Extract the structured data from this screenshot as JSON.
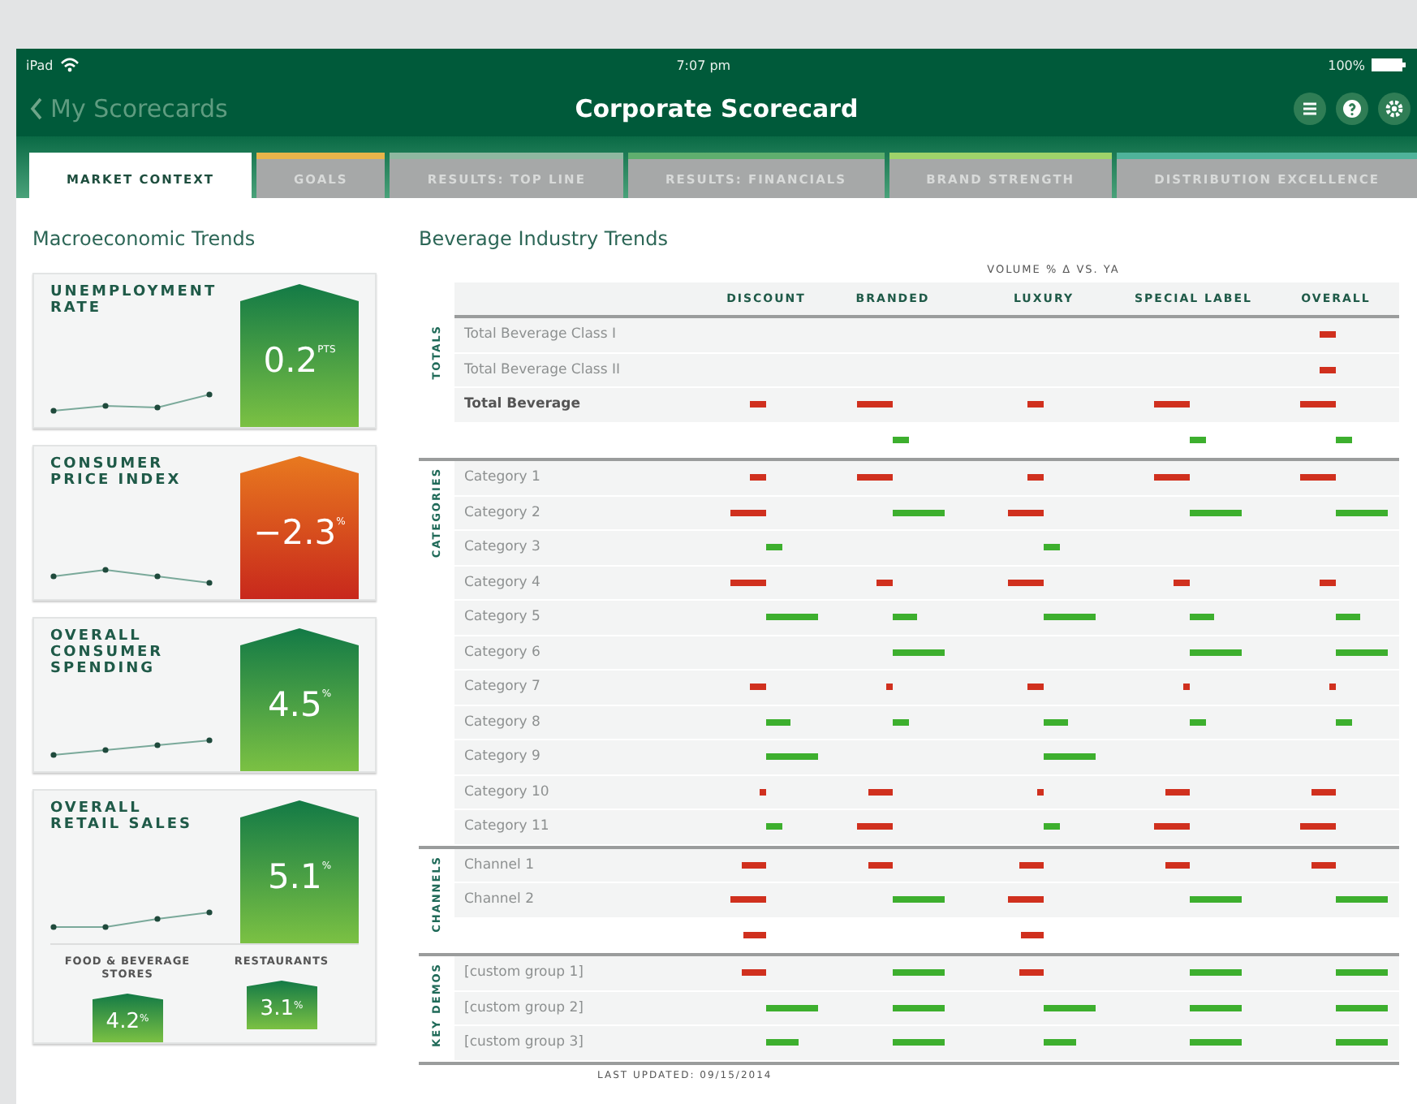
{
  "status_bar": {
    "device": "iPad",
    "time": "7:07 pm",
    "battery": "100%"
  },
  "header": {
    "back": "My Scorecards",
    "title": "Corporate Scorecard"
  },
  "tabs": [
    {
      "label": "MARKET CONTEXT",
      "selected": true,
      "color": "#ffffff"
    },
    {
      "label": "GOALS",
      "selected": false,
      "color": "#e8b44a"
    },
    {
      "label": "RESULTS: TOP LINE",
      "selected": false,
      "color": "#8fb8a0"
    },
    {
      "label": "RESULTS: FINANCIALS",
      "selected": false,
      "color": "#5fae6e"
    },
    {
      "label": "BRAND STRENGTH",
      "selected": false,
      "color": "#9fd36a"
    },
    {
      "label": "DISTRIBUTION EXCELLENCE",
      "selected": false,
      "color": "#4fb39a"
    }
  ],
  "macro": {
    "title": "Macroeconomic Trends",
    "cards": [
      {
        "title": "UNEMPLOYMENT RATE",
        "value": "0.2",
        "unit": "PTS",
        "kind": "up"
      },
      {
        "title": "CONSUMER PRICE INDEX",
        "value": "−2.3",
        "unit": "%",
        "kind": "down"
      },
      {
        "title": "OVERALL CONSUMER SPENDING",
        "value": "4.5",
        "unit": "%",
        "kind": "up"
      },
      {
        "title": "OVERALL RETAIL SALES",
        "value": "5.1",
        "unit": "%",
        "kind": "up",
        "subs": [
          {
            "title": "FOOD & BEVERAGE STORES",
            "value": "4.2",
            "unit": "%",
            "kind": "up"
          },
          {
            "title": "RESTAURANTS",
            "value": "3.1",
            "unit": "%",
            "kind": "up"
          }
        ]
      }
    ]
  },
  "industry": {
    "title": "Beverage Industry Trends",
    "group_header": "VOLUME % Δ VS. YA",
    "columns": [
      "DISCOUNT",
      "BRANDED",
      "LUXURY",
      "SPECIAL LABEL",
      "OVERALL"
    ],
    "sections": [
      {
        "label": "TOTALS",
        "rows": [
          {
            "label": "Total Beverage Class I",
            "bold": false,
            "cells": [
              null,
              null,
              null,
              null,
              {
                "kind": "down",
                "level": 0.3
              }
            ]
          },
          {
            "label": "Total Beverage Class II",
            "bold": false,
            "cells": [
              null,
              null,
              null,
              null,
              {
                "kind": "down",
                "level": 0.3
              }
            ]
          },
          {
            "label": "Total Beverage",
            "bold": true,
            "cells": [
              {
                "kind": "down",
                "level": 0.3
              },
              {
                "kind": "down",
                "level": 0.65
              },
              {
                "kind": "down",
                "level": 0.3
              },
              {
                "kind": "down",
                "level": 0.65
              },
              {
                "kind": "down",
                "level": 0.65
              }
            ]
          },
          {
            "cells": [
              null,
              {
                "kind": "up",
                "level": 0.3
              },
              null,
              {
                "kind": "up",
                "level": 0.3
              },
              {
                "kind": "up",
                "level": 0.3
              }
            ]
          }
        ]
      },
      {
        "label": "CATEGORIES",
        "rows": [
          {
            "label": "Category 1",
            "bold": false,
            "cells": [
              {
                "kind": "down",
                "level": 0.3
              },
              {
                "kind": "down",
                "level": 0.65
              },
              {
                "kind": "down",
                "level": 0.3
              },
              {
                "kind": "down",
                "level": 0.65
              },
              {
                "kind": "down",
                "level": 0.65
              }
            ]
          },
          {
            "label": "Category 2",
            "bold": false,
            "cells": [
              {
                "kind": "down",
                "level": 0.65
              },
              {
                "kind": "up",
                "level": 0.95
              },
              {
                "kind": "down",
                "level": 0.65
              },
              {
                "kind": "up",
                "level": 0.95
              },
              {
                "kind": "up",
                "level": 0.95
              }
            ]
          },
          {
            "label": "Category 3",
            "bold": false,
            "cells": [
              {
                "kind": "up",
                "level": 0.3
              },
              null,
              {
                "kind": "up",
                "level": 0.3
              },
              null,
              null
            ]
          },
          {
            "label": "Category 4",
            "bold": false,
            "cells": [
              {
                "kind": "down",
                "level": 0.65
              },
              {
                "kind": "down",
                "level": 0.3
              },
              {
                "kind": "down",
                "level": 0.65
              },
              {
                "kind": "down",
                "level": 0.3
              },
              {
                "kind": "down",
                "level": 0.3
              }
            ]
          },
          {
            "label": "Category 5",
            "bold": false,
            "cells": [
              {
                "kind": "up",
                "level": 0.95
              },
              {
                "kind": "up",
                "level": 0.45
              },
              {
                "kind": "up",
                "level": 0.95
              },
              {
                "kind": "up",
                "level": 0.45
              },
              {
                "kind": "up",
                "level": 0.45
              }
            ]
          },
          {
            "label": "Category 6",
            "bold": false,
            "cells": [
              null,
              {
                "kind": "up",
                "level": 0.95
              },
              null,
              {
                "kind": "up",
                "level": 0.95
              },
              {
                "kind": "up",
                "level": 0.95
              }
            ]
          },
          {
            "label": "Category 7",
            "bold": false,
            "cells": [
              {
                "kind": "down",
                "level": 0.3
              },
              {
                "kind": "down",
                "level": 0.12
              },
              {
                "kind": "down",
                "level": 0.3
              },
              {
                "kind": "down",
                "level": 0.12
              },
              {
                "kind": "down",
                "level": 0.12
              }
            ]
          },
          {
            "label": "Category 8",
            "bold": false,
            "cells": [
              {
                "kind": "up",
                "level": 0.45
              },
              {
                "kind": "up",
                "level": 0.3
              },
              {
                "kind": "up",
                "level": 0.45
              },
              {
                "kind": "up",
                "level": 0.3
              },
              {
                "kind": "up",
                "level": 0.3
              }
            ]
          },
          {
            "label": "Category 9",
            "bold": false,
            "cells": [
              {
                "kind": "up",
                "level": 0.95
              },
              null,
              {
                "kind": "up",
                "level": 0.95
              },
              null,
              null
            ]
          },
          {
            "label": "Category 10",
            "bold": false,
            "cells": [
              {
                "kind": "down",
                "level": 0.12
              },
              {
                "kind": "down",
                "level": 0.45
              },
              {
                "kind": "down",
                "level": 0.12
              },
              {
                "kind": "down",
                "level": 0.45
              },
              {
                "kind": "down",
                "level": 0.45
              }
            ]
          },
          {
            "label": "Category 11",
            "bold": false,
            "cells": [
              {
                "kind": "up",
                "level": 0.3
              },
              {
                "kind": "down",
                "level": 0.65
              },
              {
                "kind": "up",
                "level": 0.3
              },
              {
                "kind": "down",
                "level": 0.65
              },
              {
                "kind": "down",
                "level": 0.65
              }
            ]
          }
        ]
      },
      {
        "label": "CHANNELS",
        "rows": [
          {
            "label": "Channel 1",
            "bold": false,
            "cells": [
              {
                "kind": "down",
                "level": 0.45
              },
              {
                "kind": "down",
                "level": 0.45
              },
              {
                "kind": "down",
                "level": 0.45
              },
              {
                "kind": "down",
                "level": 0.45
              },
              {
                "kind": "down",
                "level": 0.45
              }
            ]
          },
          {
            "label": "Channel 2",
            "bold": false,
            "cells": [
              {
                "kind": "down",
                "level": 0.65
              },
              {
                "kind": "up",
                "level": 0.95
              },
              {
                "kind": "down",
                "level": 0.65
              },
              {
                "kind": "up",
                "level": 0.95
              },
              {
                "kind": "up",
                "level": 0.95
              }
            ]
          },
          {
            "cells": [
              {
                "kind": "down",
                "level": 0.4
              },
              null,
              {
                "kind": "down",
                "level": 0.4
              },
              null,
              null
            ]
          }
        ]
      },
      {
        "label": "KEY DEMOS",
        "rows": [
          {
            "label": "[custom group 1]",
            "bold": false,
            "cells": [
              {
                "kind": "down",
                "level": 0.45
              },
              {
                "kind": "up",
                "level": 0.95
              },
              {
                "kind": "down",
                "level": 0.45
              },
              {
                "kind": "up",
                "level": 0.95
              },
              {
                "kind": "up",
                "level": 0.95
              }
            ]
          },
          {
            "label": "[custom group 2]",
            "bold": false,
            "cells": [
              {
                "kind": "up",
                "level": 0.95
              },
              {
                "kind": "up",
                "level": 0.95
              },
              {
                "kind": "up",
                "level": 0.95
              },
              {
                "kind": "up",
                "level": 0.95
              },
              {
                "kind": "up",
                "level": 0.95
              }
            ]
          },
          {
            "label": "[custom group 3]",
            "bold": false,
            "cells": [
              {
                "kind": "up",
                "level": 0.6
              },
              {
                "kind": "up",
                "level": 0.95
              },
              {
                "kind": "up",
                "level": 0.6
              },
              {
                "kind": "up",
                "level": 0.95
              },
              {
                "kind": "up",
                "level": 0.95
              }
            ]
          }
        ]
      }
    ],
    "footer": "LAST UPDATED: 09/15/2014"
  }
}
